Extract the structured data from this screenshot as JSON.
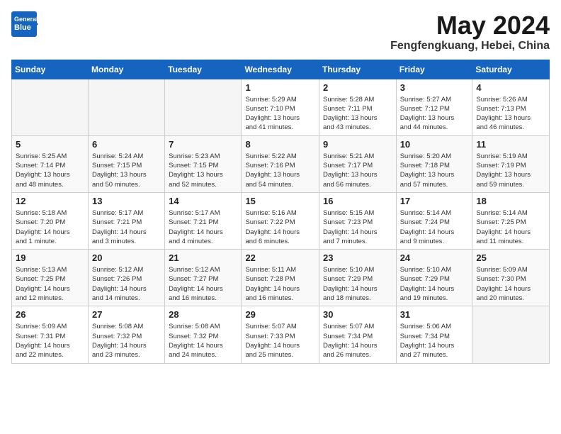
{
  "header": {
    "logo_line1": "General",
    "logo_line2": "Blue",
    "month_title": "May 2024",
    "location": "Fengfengkuang, Hebei, China"
  },
  "calendar": {
    "days_of_week": [
      "Sunday",
      "Monday",
      "Tuesday",
      "Wednesday",
      "Thursday",
      "Friday",
      "Saturday"
    ],
    "weeks": [
      [
        {
          "day": "",
          "info": ""
        },
        {
          "day": "",
          "info": ""
        },
        {
          "day": "",
          "info": ""
        },
        {
          "day": "1",
          "info": "Sunrise: 5:29 AM\nSunset: 7:10 PM\nDaylight: 13 hours\nand 41 minutes."
        },
        {
          "day": "2",
          "info": "Sunrise: 5:28 AM\nSunset: 7:11 PM\nDaylight: 13 hours\nand 43 minutes."
        },
        {
          "day": "3",
          "info": "Sunrise: 5:27 AM\nSunset: 7:12 PM\nDaylight: 13 hours\nand 44 minutes."
        },
        {
          "day": "4",
          "info": "Sunrise: 5:26 AM\nSunset: 7:13 PM\nDaylight: 13 hours\nand 46 minutes."
        }
      ],
      [
        {
          "day": "5",
          "info": "Sunrise: 5:25 AM\nSunset: 7:14 PM\nDaylight: 13 hours\nand 48 minutes."
        },
        {
          "day": "6",
          "info": "Sunrise: 5:24 AM\nSunset: 7:15 PM\nDaylight: 13 hours\nand 50 minutes."
        },
        {
          "day": "7",
          "info": "Sunrise: 5:23 AM\nSunset: 7:15 PM\nDaylight: 13 hours\nand 52 minutes."
        },
        {
          "day": "8",
          "info": "Sunrise: 5:22 AM\nSunset: 7:16 PM\nDaylight: 13 hours\nand 54 minutes."
        },
        {
          "day": "9",
          "info": "Sunrise: 5:21 AM\nSunset: 7:17 PM\nDaylight: 13 hours\nand 56 minutes."
        },
        {
          "day": "10",
          "info": "Sunrise: 5:20 AM\nSunset: 7:18 PM\nDaylight: 13 hours\nand 57 minutes."
        },
        {
          "day": "11",
          "info": "Sunrise: 5:19 AM\nSunset: 7:19 PM\nDaylight: 13 hours\nand 59 minutes."
        }
      ],
      [
        {
          "day": "12",
          "info": "Sunrise: 5:18 AM\nSunset: 7:20 PM\nDaylight: 14 hours\nand 1 minute."
        },
        {
          "day": "13",
          "info": "Sunrise: 5:17 AM\nSunset: 7:21 PM\nDaylight: 14 hours\nand 3 minutes."
        },
        {
          "day": "14",
          "info": "Sunrise: 5:17 AM\nSunset: 7:21 PM\nDaylight: 14 hours\nand 4 minutes."
        },
        {
          "day": "15",
          "info": "Sunrise: 5:16 AM\nSunset: 7:22 PM\nDaylight: 14 hours\nand 6 minutes."
        },
        {
          "day": "16",
          "info": "Sunrise: 5:15 AM\nSunset: 7:23 PM\nDaylight: 14 hours\nand 7 minutes."
        },
        {
          "day": "17",
          "info": "Sunrise: 5:14 AM\nSunset: 7:24 PM\nDaylight: 14 hours\nand 9 minutes."
        },
        {
          "day": "18",
          "info": "Sunrise: 5:14 AM\nSunset: 7:25 PM\nDaylight: 14 hours\nand 11 minutes."
        }
      ],
      [
        {
          "day": "19",
          "info": "Sunrise: 5:13 AM\nSunset: 7:25 PM\nDaylight: 14 hours\nand 12 minutes."
        },
        {
          "day": "20",
          "info": "Sunrise: 5:12 AM\nSunset: 7:26 PM\nDaylight: 14 hours\nand 14 minutes."
        },
        {
          "day": "21",
          "info": "Sunrise: 5:12 AM\nSunset: 7:27 PM\nDaylight: 14 hours\nand 16 minutes."
        },
        {
          "day": "22",
          "info": "Sunrise: 5:11 AM\nSunset: 7:28 PM\nDaylight: 14 hours\nand 16 minutes."
        },
        {
          "day": "23",
          "info": "Sunrise: 5:10 AM\nSunset: 7:29 PM\nDaylight: 14 hours\nand 18 minutes."
        },
        {
          "day": "24",
          "info": "Sunrise: 5:10 AM\nSunset: 7:29 PM\nDaylight: 14 hours\nand 19 minutes."
        },
        {
          "day": "25",
          "info": "Sunrise: 5:09 AM\nSunset: 7:30 PM\nDaylight: 14 hours\nand 20 minutes."
        }
      ],
      [
        {
          "day": "26",
          "info": "Sunrise: 5:09 AM\nSunset: 7:31 PM\nDaylight: 14 hours\nand 22 minutes."
        },
        {
          "day": "27",
          "info": "Sunrise: 5:08 AM\nSunset: 7:32 PM\nDaylight: 14 hours\nand 23 minutes."
        },
        {
          "day": "28",
          "info": "Sunrise: 5:08 AM\nSunset: 7:32 PM\nDaylight: 14 hours\nand 24 minutes."
        },
        {
          "day": "29",
          "info": "Sunrise: 5:07 AM\nSunset: 7:33 PM\nDaylight: 14 hours\nand 25 minutes."
        },
        {
          "day": "30",
          "info": "Sunrise: 5:07 AM\nSunset: 7:34 PM\nDaylight: 14 hours\nand 26 minutes."
        },
        {
          "day": "31",
          "info": "Sunrise: 5:06 AM\nSunset: 7:34 PM\nDaylight: 14 hours\nand 27 minutes."
        },
        {
          "day": "",
          "info": ""
        }
      ]
    ]
  }
}
